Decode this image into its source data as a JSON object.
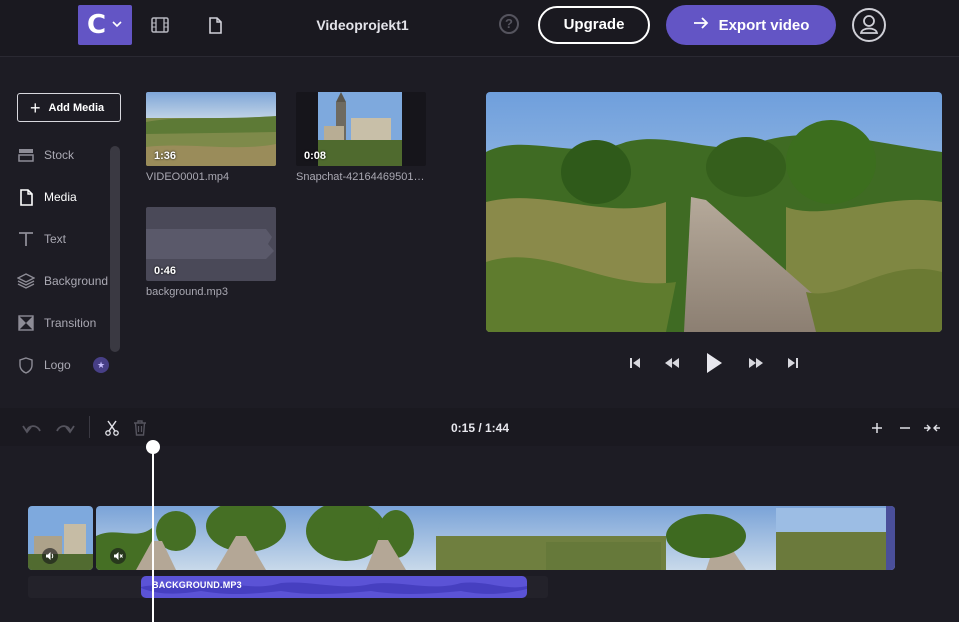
{
  "header": {
    "logo_letter": "C",
    "project_title": "Videoprojekt1",
    "help_label": "?",
    "upgrade_label": "Upgrade",
    "export_label": "Export video",
    "icons": [
      "film-icon",
      "document-icon",
      "help-icon",
      "account-icon"
    ]
  },
  "sidebar": {
    "add_media_label": "Add Media",
    "items": [
      {
        "label": "Stock",
        "icon": "stock-icon"
      },
      {
        "label": "Media",
        "icon": "media-file-icon",
        "active": true
      },
      {
        "label": "Text",
        "icon": "text-icon"
      },
      {
        "label": "Background",
        "icon": "layers-icon"
      },
      {
        "label": "Transition",
        "icon": "transition-icon"
      },
      {
        "label": "Logo",
        "icon": "shield-icon",
        "badge": "★"
      }
    ]
  },
  "media": [
    {
      "name": "VIDEO0001.mp4",
      "duration": "1:36"
    },
    {
      "name": "Snapchat-42164469501…",
      "duration": "0:08"
    },
    {
      "name": "background.mp3",
      "duration": "0:46"
    }
  ],
  "timeline": {
    "timecode": "0:15 / 1:44",
    "audio_clip_label": "BACKGROUND.MP3"
  },
  "colors": {
    "accent": "#6355c5",
    "background": "#1d1c24",
    "audio_clip": "#5b53d6"
  }
}
